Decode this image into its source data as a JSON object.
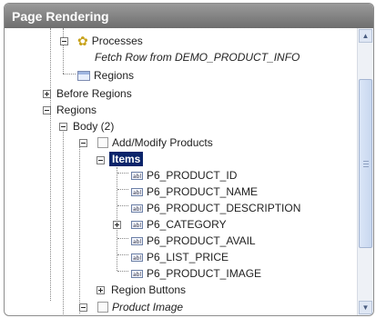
{
  "panel": {
    "title": "Page Rendering"
  },
  "tree": {
    "processes": "Processes",
    "fetch_row": "Fetch Row from DEMO_PRODUCT_INFO",
    "regions_sub": "Regions",
    "before_regions": "Before Regions",
    "regions": "Regions",
    "body": "Body (2)",
    "add_modify": "Add/Modify Products",
    "items": "Items",
    "item_list": [
      "P6_PRODUCT_ID",
      "P6_PRODUCT_NAME",
      "P6_PRODUCT_DESCRIPTION",
      "P6_CATEGORY",
      "P6_PRODUCT_AVAIL",
      "P6_LIST_PRICE",
      "P6_PRODUCT_IMAGE"
    ],
    "region_buttons": "Region Buttons",
    "product_image": "Product Image"
  },
  "icons": {
    "item_icon_text": "abl",
    "gear_glyph": "✿"
  },
  "colors": {
    "header_bg": "#7f7f7f",
    "selection_bg": "#0a246a"
  }
}
